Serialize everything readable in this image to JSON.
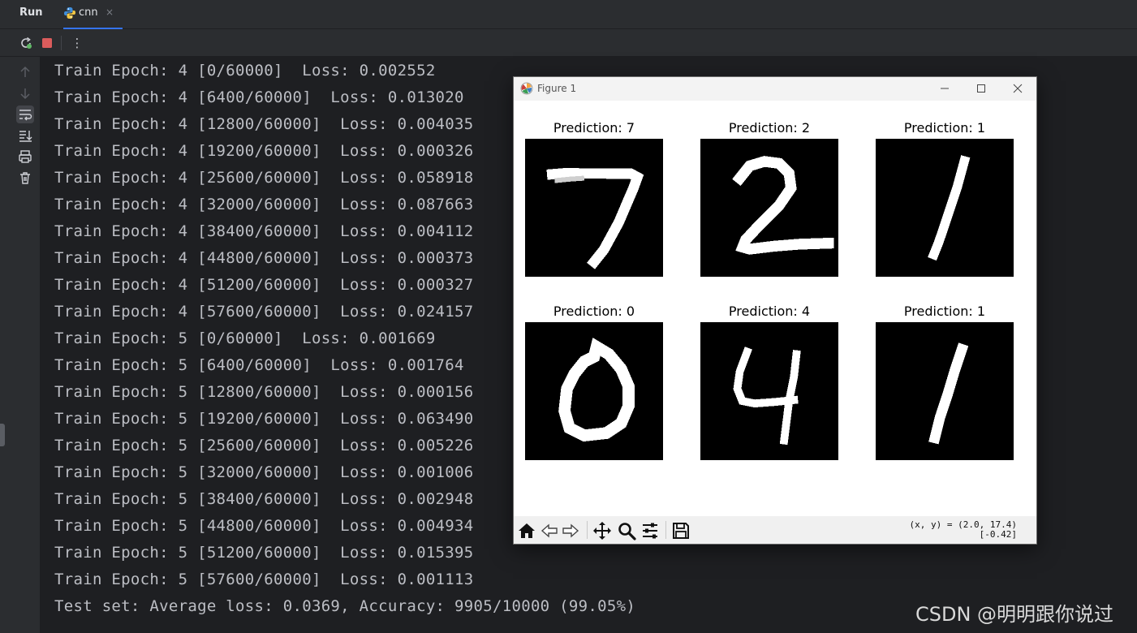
{
  "tool_window": {
    "title": "Run",
    "tab": {
      "label": "cnn",
      "close": "×"
    }
  },
  "toolbar": {
    "buttons": [
      "rerun-icon",
      "stop-icon",
      "more-vertical-icon"
    ],
    "more_label": "⋮"
  },
  "side_actions": [
    "up-arrow-icon",
    "down-arrow-icon",
    "soft-wrap-icon",
    "scroll-to-end-icon",
    "print-icon",
    "trash-icon"
  ],
  "console": {
    "lines": [
      "Train Epoch: 4 [0/60000]  Loss: 0.002552",
      "Train Epoch: 4 [6400/60000]  Loss: 0.013020",
      "Train Epoch: 4 [12800/60000]  Loss: 0.004035",
      "Train Epoch: 4 [19200/60000]  Loss: 0.000326",
      "Train Epoch: 4 [25600/60000]  Loss: 0.058918",
      "Train Epoch: 4 [32000/60000]  Loss: 0.087663",
      "Train Epoch: 4 [38400/60000]  Loss: 0.004112",
      "Train Epoch: 4 [44800/60000]  Loss: 0.000373",
      "Train Epoch: 4 [51200/60000]  Loss: 0.000327",
      "Train Epoch: 4 [57600/60000]  Loss: 0.024157",
      "Train Epoch: 5 [0/60000]  Loss: 0.001669",
      "Train Epoch: 5 [6400/60000]  Loss: 0.001764",
      "Train Epoch: 5 [12800/60000]  Loss: 0.000156",
      "Train Epoch: 5 [19200/60000]  Loss: 0.063490",
      "Train Epoch: 5 [25600/60000]  Loss: 0.005226",
      "Train Epoch: 5 [32000/60000]  Loss: 0.001006",
      "Train Epoch: 5 [38400/60000]  Loss: 0.002948",
      "Train Epoch: 5 [44800/60000]  Loss: 0.004934",
      "Train Epoch: 5 [51200/60000]  Loss: 0.015395",
      "Train Epoch: 5 [57600/60000]  Loss: 0.001113",
      "Test set: Average loss: 0.0369, Accuracy: 9905/10000 (99.05%)"
    ]
  },
  "figure": {
    "title": "Figure 1",
    "window_buttons": [
      "minimize-icon",
      "maximize-icon",
      "close-icon"
    ],
    "subplots": [
      {
        "title": "Prediction: 7",
        "digit": "7"
      },
      {
        "title": "Prediction: 2",
        "digit": "2"
      },
      {
        "title": "Prediction: 1",
        "digit": "1"
      },
      {
        "title": "Prediction: 0",
        "digit": "0"
      },
      {
        "title": "Prediction: 4",
        "digit": "4"
      },
      {
        "title": "Prediction: 1",
        "digit": "1"
      }
    ],
    "toolbar_buttons": [
      "home-icon",
      "back-icon",
      "forward-icon",
      "pan-icon",
      "zoom-icon",
      "configure-subplots-icon",
      "save-icon"
    ],
    "coordinates": {
      "line1": "(x, y) = (2.0, 17.4)",
      "line2": "[-0.42]"
    }
  },
  "watermark": "CSDN @明明跟你说过",
  "colors": {
    "background": "#1e1f22",
    "panel": "#2b2d30",
    "console_text": "#bcbec4",
    "tab_underline": "#3574f0",
    "stop_red": "#db5c5c",
    "rerun_green": "#5fb865"
  }
}
